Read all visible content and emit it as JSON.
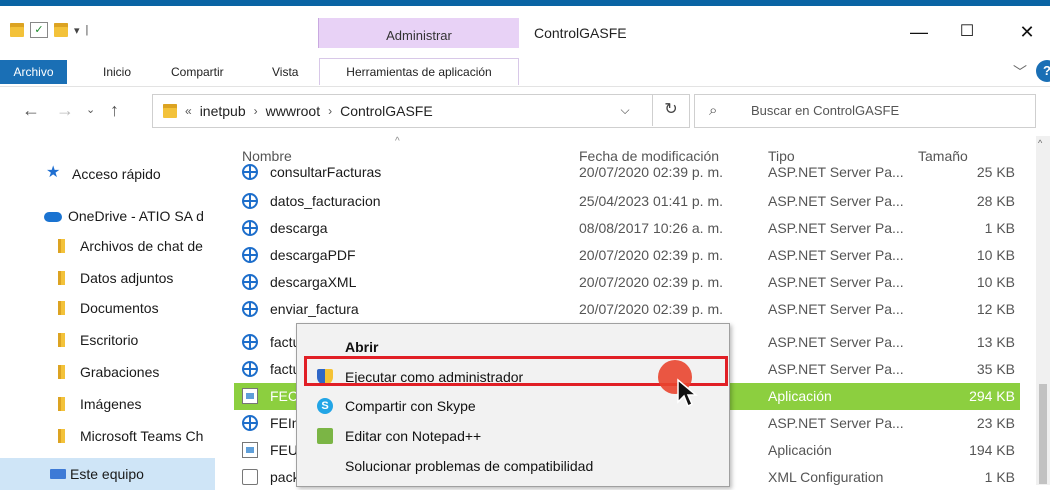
{
  "window": {
    "title": "ControlGASFE",
    "context_tab": "Administrar",
    "controls": {
      "minimize": "—",
      "maximize": "☐",
      "close": "✕"
    }
  },
  "ribbon": {
    "file_tab": "Archivo",
    "tabs": [
      "Inicio",
      "Compartir",
      "Vista"
    ],
    "context_subtab": "Herramientas de aplicación",
    "help": "?"
  },
  "address": {
    "overflow": "«",
    "path": [
      "inetpub",
      "wwwroot",
      "ControlGASFE"
    ]
  },
  "search": {
    "placeholder": "Buscar en ControlGASFE"
  },
  "nav": {
    "quick_access": "Acceso rápido",
    "onedrive": "OneDrive - ATIO SA d",
    "folders": [
      "Archivos de chat de",
      "Datos adjuntos",
      "Documentos",
      "Escritorio",
      "Grabaciones",
      "Imágenes",
      "Microsoft Teams Ch"
    ],
    "this_pc": "Este equipo"
  },
  "columns": {
    "name": "Nombre",
    "date": "Fecha de modificación",
    "type": "Tipo",
    "size": "Tamaño"
  },
  "files": [
    {
      "name": "consultarFacturas",
      "date": "20/07/2020 02:39 p. m.",
      "type": "ASP.NET Server Pa...",
      "size": "25 KB",
      "icon": "globe-icon"
    },
    {
      "name": "datos_facturacion",
      "date": "25/04/2023 01:41 p. m.",
      "type": "ASP.NET Server Pa...",
      "size": "28 KB",
      "icon": "globe-icon"
    },
    {
      "name": "descarga",
      "date": "08/08/2017 10:26 a. m.",
      "type": "ASP.NET Server Pa...",
      "size": "1 KB",
      "icon": "globe-icon"
    },
    {
      "name": "descargaPDF",
      "date": "20/07/2020 02:39 p. m.",
      "type": "ASP.NET Server Pa...",
      "size": "10 KB",
      "icon": "globe-icon"
    },
    {
      "name": "descargaXML",
      "date": "20/07/2020 02:39 p. m.",
      "type": "ASP.NET Server Pa...",
      "size": "10 KB",
      "icon": "globe-icon"
    },
    {
      "name": "enviar_factura",
      "date": "20/07/2020 02:39 p. m.",
      "type": "ASP.NET Server Pa...",
      "size": "12 KB",
      "icon": "globe-icon"
    },
    {
      "name": "factu",
      "date": "m.",
      "type": "ASP.NET Server Pa...",
      "size": "13 KB",
      "icon": "globe-icon"
    },
    {
      "name": "factu",
      "date": "m.",
      "type": "ASP.NET Server Pa...",
      "size": "35 KB",
      "icon": "globe-icon"
    },
    {
      "name": "FECo",
      "date": "m.",
      "type": "Aplicación",
      "size": "294 KB",
      "icon": "exe-icon"
    },
    {
      "name": "FEIni",
      "date": "m.",
      "type": "ASP.NET Server Pa...",
      "size": "23 KB",
      "icon": "globe-icon"
    },
    {
      "name": "FEUD",
      "date": "m.",
      "type": "Aplicación",
      "size": "194 KB",
      "icon": "exe-icon"
    },
    {
      "name": "pack",
      "date": "m.",
      "type": "XML Configuration",
      "size": "1 KB",
      "icon": "xml-icon"
    }
  ],
  "context_menu": {
    "items": [
      "Abrir",
      "Ejecutar como administrador",
      "Compartir con Skype",
      "Editar con Notepad++",
      "Solucionar problemas de compatibilidad"
    ]
  },
  "colors": {
    "highlight_row": "#8ccf3f",
    "admin_tab": "#e8d2f6",
    "file_tab": "#1a6fb5",
    "red_box": "#e11f26"
  }
}
